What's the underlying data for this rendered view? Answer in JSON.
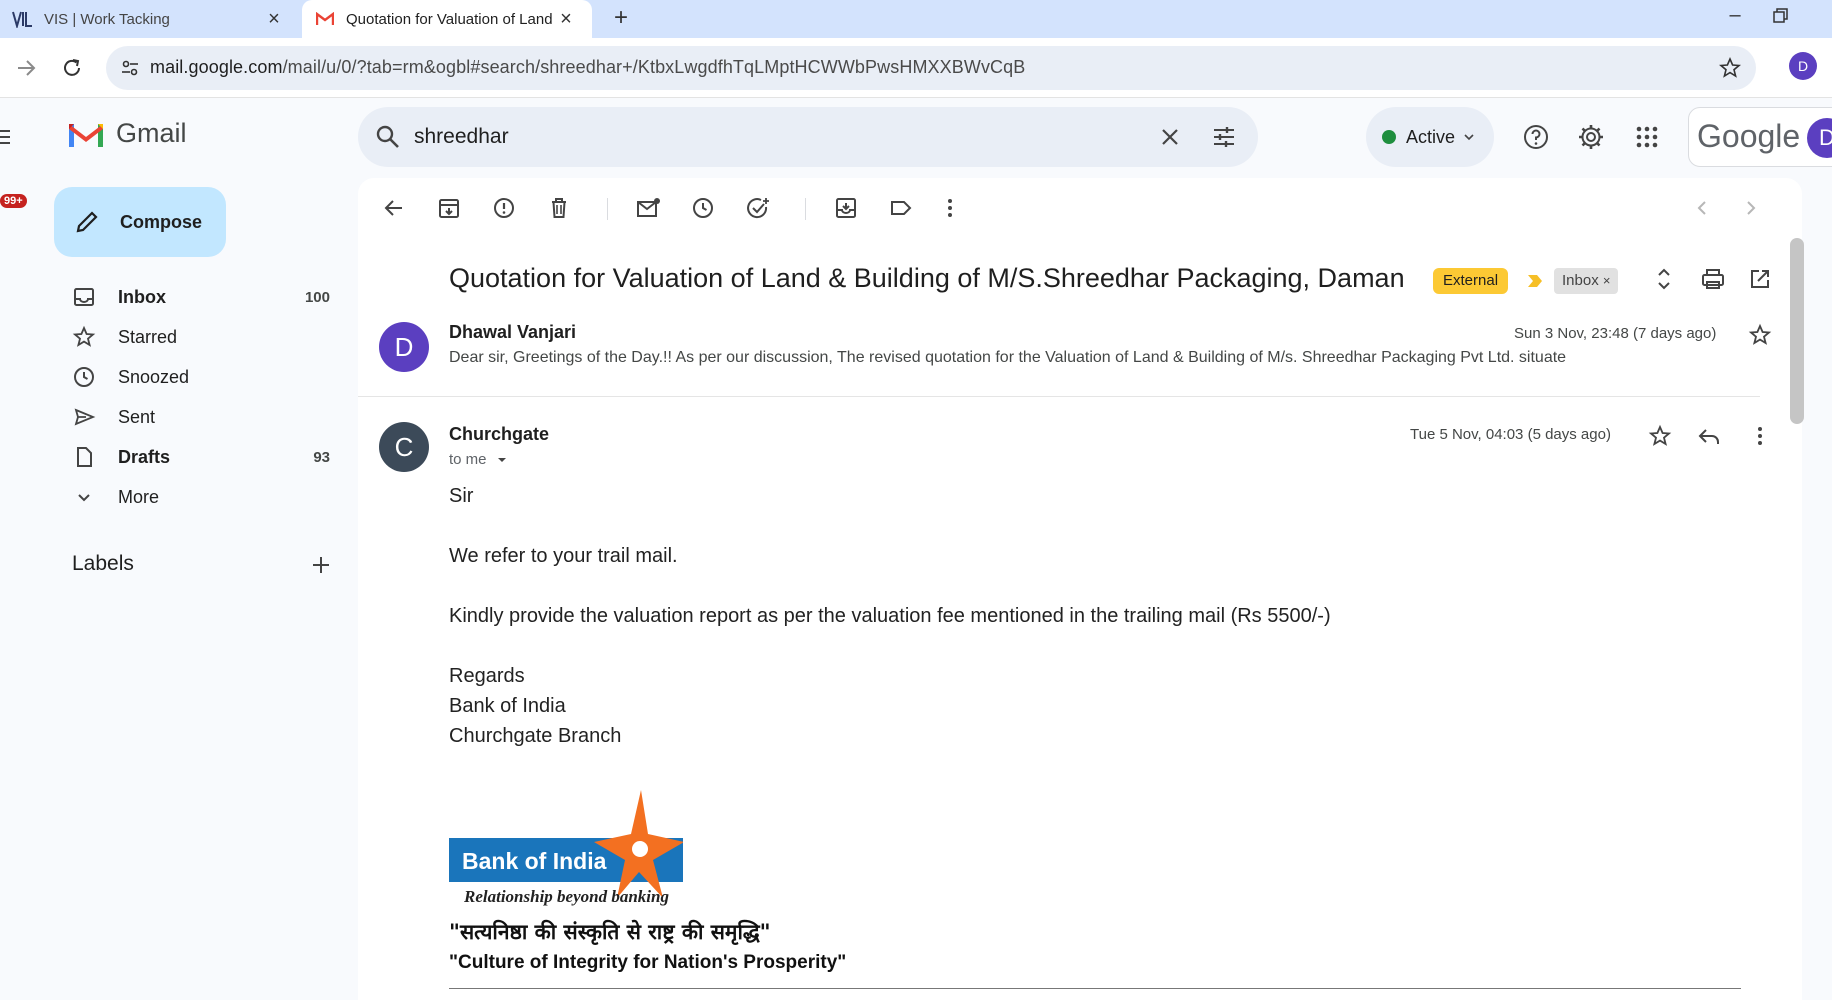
{
  "browser": {
    "tabs": [
      {
        "title": "VIS | Work Tacking"
      },
      {
        "title": "Quotation for Valuation of Land"
      }
    ],
    "url_host": "mail.google.com",
    "url_path": "/mail/u/0/?tab=rm&ogbl#search/shreedhar+/KtbxLwgdfhTqLMptHCWWbPwsHMXXBWvCqB",
    "profile_initial": "D"
  },
  "gmail": {
    "brand": "Gmail",
    "rail_badge": "99+",
    "search_value": "shreedhar",
    "status": "Active",
    "google_word": "Google",
    "account_initial": "D",
    "compose_label": "Compose",
    "nav": [
      {
        "label": "Inbox",
        "count": "100"
      },
      {
        "label": "Starred",
        "count": ""
      },
      {
        "label": "Snoozed",
        "count": ""
      },
      {
        "label": "Sent",
        "count": ""
      },
      {
        "label": "Drafts",
        "count": "93"
      },
      {
        "label": "More",
        "count": ""
      }
    ],
    "labels_title": "Labels"
  },
  "thread": {
    "subject": "Quotation for Valuation of Land & Building of M/S.Shreedhar Packaging, Daman",
    "tag_external": "External",
    "tag_inbox": "Inbox",
    "messages": [
      {
        "initial": "D",
        "sender": "Dhawal Vanjari",
        "date": "Sun 3 Nov, 23:48 (7 days ago)",
        "snippet": "Dear sir, Greetings of the Day.!! As per our discussion, The revised quotation for the Valuation of Land & Building of M/s. Shreedhar Packaging Pvt Ltd. situate"
      },
      {
        "initial": "C",
        "sender": "Churchgate",
        "date": "Tue 5 Nov, 04:03 (5 days ago)",
        "to": "to me",
        "body": {
          "greeting": "Sir",
          "line1": "We refer to your trail mail.",
          "line2": "Kindly provide the valuation report as per the valuation fee mentioned in the trailing mail (Rs 5500/-)",
          "regards": "Regards",
          "org": "Bank of India",
          "branch": "Churchgate Branch"
        },
        "signature": {
          "logo_text": "Bank of India",
          "logo_tagline": "Relationship beyond banking",
          "hindi_motto": "\"सत्यनिष्ठा की संस्कृति से राष्ट्र की समृद्धि\"",
          "english_motto": "\"Culture of Integrity for Nation's Prosperity\""
        }
      }
    ]
  },
  "colors": {
    "tabstrip": "#d3e3fd",
    "compose": "#c2e7ff",
    "external_tag": "#fcc934",
    "avatar_d": "#5b3fc0",
    "avatar_c": "#3c4a59",
    "boi_blue": "#1a75bb",
    "boi_orange": "#f37021"
  }
}
